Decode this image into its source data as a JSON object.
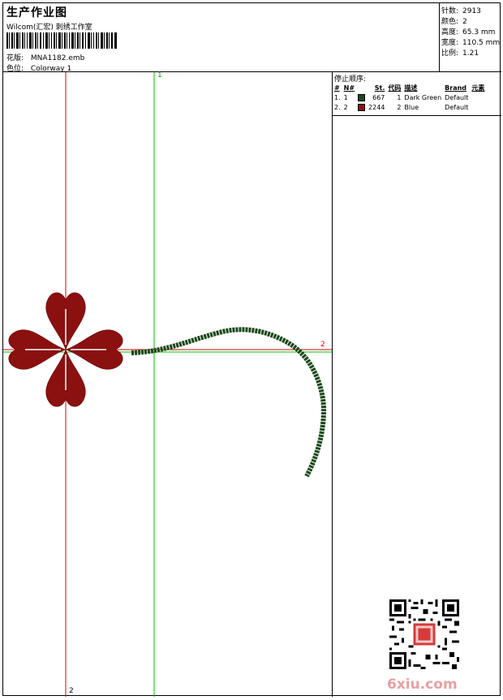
{
  "header": {
    "title": "生产作业图",
    "studio": "Wilcom(汇宏) 刺绣工作室",
    "design_label": "花版:",
    "design_value": "MNA1182.emb",
    "colorway_label": "色位:",
    "colorway_value": "Colorway 1"
  },
  "stats": [
    {
      "label": "针数:",
      "value": "2913"
    },
    {
      "label": "颜色:",
      "value": "2"
    },
    {
      "label": "高度:",
      "value": "65.3 mm"
    },
    {
      "label": "宽度:",
      "value": "110.5 mm"
    },
    {
      "label": "比例:",
      "value": "1.21"
    }
  ],
  "stop_sequence": {
    "title": "停止顺序:",
    "headers": [
      "#",
      "N#",
      "",
      "St.",
      "代码",
      "描述",
      "Brand",
      "元素"
    ],
    "rows": [
      {
        "index": "1.",
        "n": "1",
        "color": "#1a4a1a",
        "stitches": "667",
        "code": "1",
        "desc": "Dark Green",
        "brand": "Default"
      },
      {
        "index": "2.",
        "n": "2",
        "color": "#8b1010",
        "stitches": "2244",
        "code": "2",
        "desc": "Blue",
        "brand": "Default"
      }
    ]
  },
  "axis_labels": {
    "green_top": "1",
    "red_right": "2",
    "red_bottom": "2"
  },
  "watermark": "6xiu.com"
}
